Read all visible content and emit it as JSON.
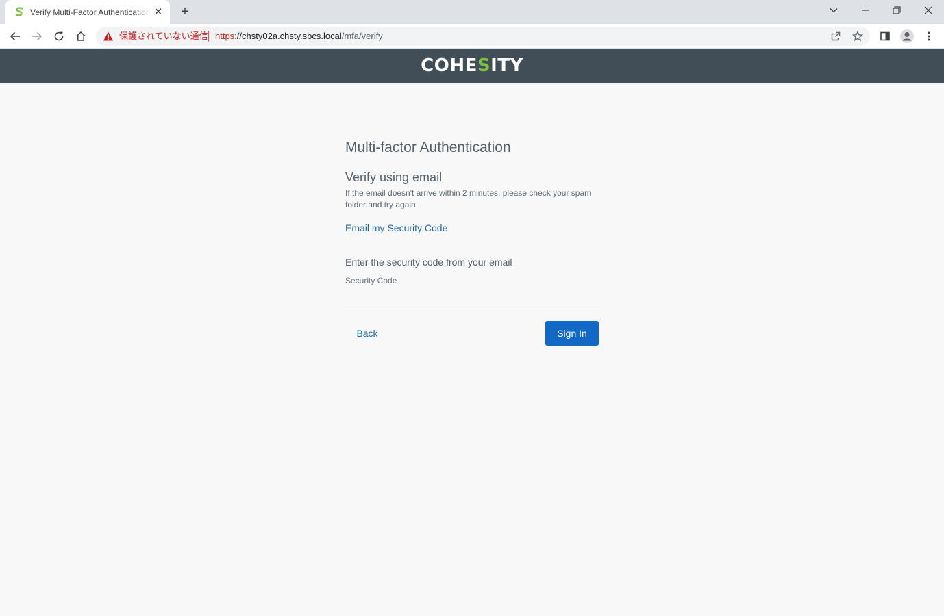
{
  "browser": {
    "tab": {
      "title": "Verify Multi-Factor Authentication",
      "favicon": "cohesity-s-icon"
    },
    "new_tab_label": "+",
    "security_warning": "保護されていない通信",
    "url": {
      "scheme": "https",
      "rest_host": "://chsty02a.chsty.sbcs.local",
      "path": "/mfa/verify"
    }
  },
  "app": {
    "logo": {
      "prefix": "COHE",
      "accent": "S",
      "suffix": "ITY",
      "accent_color": "#7cc142"
    },
    "header_color": "#414e58"
  },
  "mfa": {
    "title": "Multi-factor Authentication",
    "subtitle": "Verify using email",
    "help_text": "If the email doesn't arrive within 2 minutes, please check your spam folder and try again.",
    "email_link": "Email my Security Code",
    "enter_label": "Enter the security code from your email",
    "code_field": {
      "placeholder": "Security Code",
      "value": ""
    },
    "back_label": "Back",
    "signin_label": "Sign In",
    "primary_color": "#1168c5"
  }
}
